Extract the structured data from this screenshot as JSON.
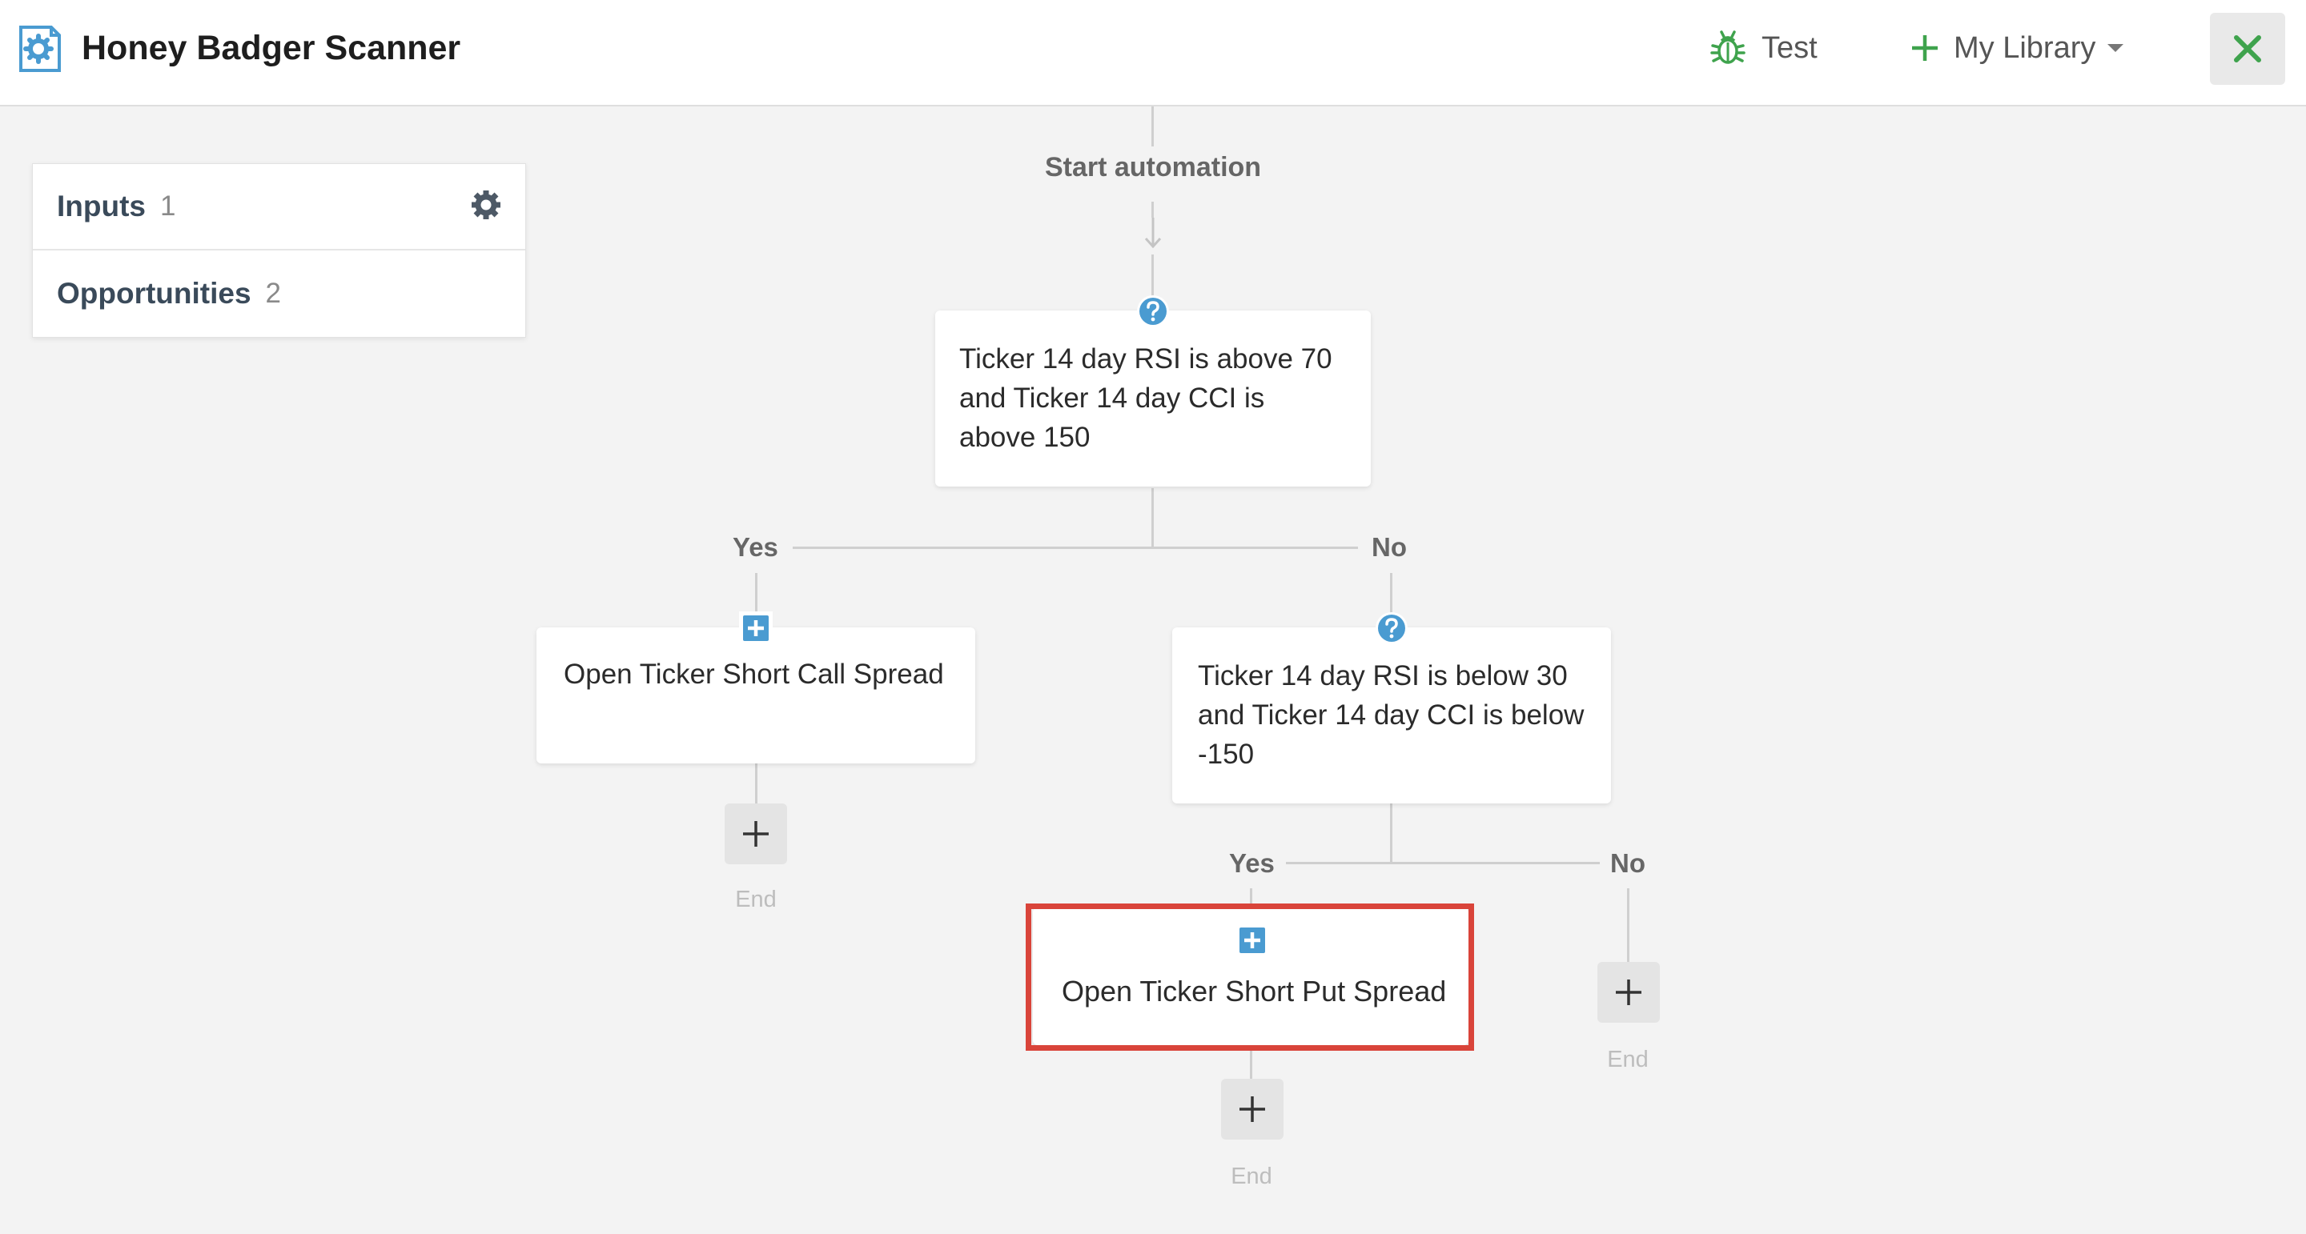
{
  "header": {
    "title": "Honey Badger Scanner",
    "test_label": "Test",
    "library_label": "My Library"
  },
  "panel": {
    "inputs_label": "Inputs",
    "inputs_count": "1",
    "opportunities_label": "Opportunities",
    "opportunities_count": "2"
  },
  "flow": {
    "start_label": "Start automation",
    "condition1": "Ticker 14 day RSI is above 70 and Ticker 14 day CCI is above 150",
    "yes_label": "Yes",
    "no_label": "No",
    "action_call": "Open Ticker Short Call Spread",
    "condition2": "Ticker 14 day RSI is below 30 and Ticker 14 day CCI is below -150",
    "action_put": "Open Ticker Short Put Spread",
    "end_label": "End"
  },
  "colors": {
    "accent_blue": "#4a9bd1",
    "accent_green": "#3fa34d",
    "highlight_red": "#d9443a"
  },
  "icons": [
    "app-gear-icon",
    "bug-icon",
    "plus-icon",
    "caret-down-icon",
    "close-icon",
    "gear-icon",
    "question-icon",
    "add-action-icon",
    "arrow-down-icon"
  ]
}
